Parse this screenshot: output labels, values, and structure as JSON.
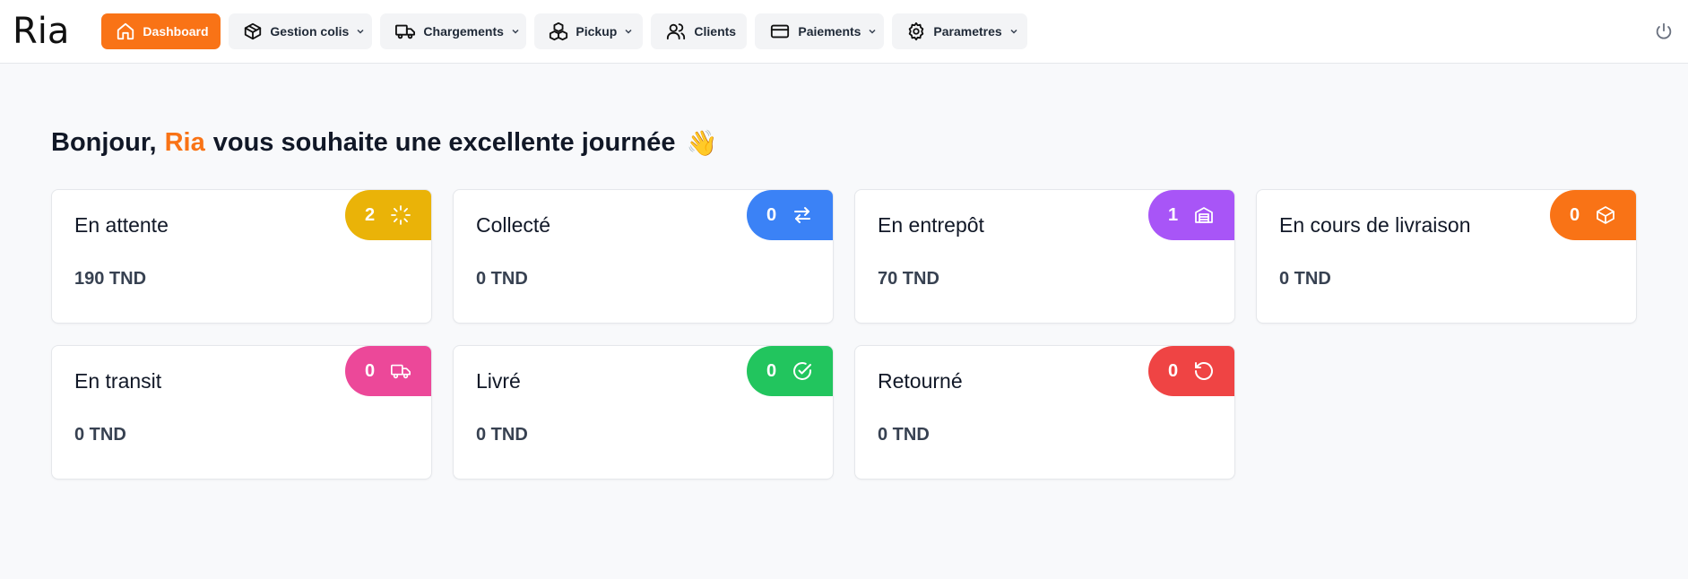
{
  "app": {
    "logo": "Ria"
  },
  "nav": {
    "items": [
      {
        "label": "Dashboard",
        "icon": "home-icon",
        "active": true,
        "dropdown": false
      },
      {
        "label": "Gestion colis",
        "icon": "package-icon",
        "active": false,
        "dropdown": true
      },
      {
        "label": "Chargements",
        "icon": "truck-icon",
        "active": false,
        "dropdown": true
      },
      {
        "label": "Pickup",
        "icon": "boxes-icon",
        "active": false,
        "dropdown": true
      },
      {
        "label": "Clients",
        "icon": "users-icon",
        "active": false,
        "dropdown": false
      },
      {
        "label": "Paiements",
        "icon": "credit-card-icon",
        "active": false,
        "dropdown": true
      },
      {
        "label": "Parametres",
        "icon": "gear-icon",
        "active": false,
        "dropdown": true
      }
    ]
  },
  "greeting": {
    "prefix": "Bonjour,",
    "brand": "Ria",
    "rest": "vous souhaite une excellente journée",
    "emoji": "👋"
  },
  "cards": [
    {
      "title": "En attente",
      "count": "2",
      "amount": "190 TND",
      "color": "#eab308",
      "icon": "loader-icon"
    },
    {
      "title": "Collecté",
      "count": "0",
      "amount": "0 TND",
      "color": "#3b82f6",
      "icon": "arrows-swap-icon"
    },
    {
      "title": "En entrepôt",
      "count": "1",
      "amount": "70 TND",
      "color": "#a855f7",
      "icon": "warehouse-icon"
    },
    {
      "title": "En cours de livraison",
      "count": "0",
      "amount": "0 TND",
      "color": "#f97316",
      "icon": "package-icon"
    },
    {
      "title": "En transit",
      "count": "0",
      "amount": "0 TND",
      "color": "#ec4899",
      "icon": "truck-icon"
    },
    {
      "title": "Livré",
      "count": "0",
      "amount": "0 TND",
      "color": "#22c55e",
      "icon": "check-circle-icon"
    },
    {
      "title": "Retourné",
      "count": "0",
      "amount": "0 TND",
      "color": "#ef4444",
      "icon": "rotate-ccw-icon"
    }
  ]
}
